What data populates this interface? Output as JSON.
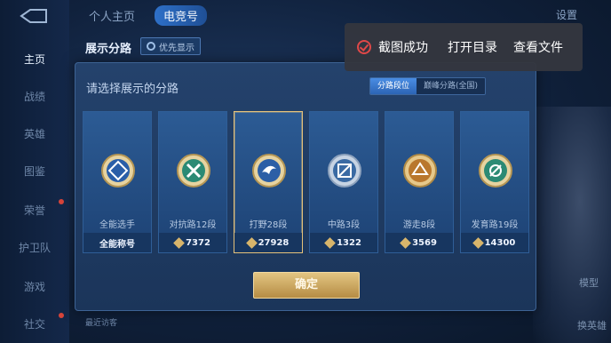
{
  "sidebar": {
    "items": [
      {
        "label": "主页"
      },
      {
        "label": "战绩"
      },
      {
        "label": "英雄"
      },
      {
        "label": "图鉴"
      },
      {
        "label": "荣誉"
      },
      {
        "label": "护卫队"
      },
      {
        "label": "游戏"
      },
      {
        "label": "社交"
      }
    ]
  },
  "topbar": {
    "tabs": [
      {
        "label": "个人主页"
      },
      {
        "label": "电竞号"
      }
    ],
    "settings": "设置"
  },
  "modal": {
    "title": "展示分路",
    "pref_button": "优先显示",
    "prompt": "请选择展示的分路",
    "segments": [
      {
        "label": "分路段位"
      },
      {
        "label": "巅峰分路(全国)"
      }
    ],
    "cards": [
      {
        "name": "全能选手",
        "value": "全能称号",
        "icon": "all-round-emblem",
        "show_coin": false
      },
      {
        "name": "对抗路12段",
        "value": "7372",
        "icon": "clash-lane-emblem",
        "show_coin": true
      },
      {
        "name": "打野28段",
        "value": "27928",
        "icon": "jungle-emblem",
        "show_coin": true
      },
      {
        "name": "中路3段",
        "value": "1322",
        "icon": "mid-lane-emblem",
        "show_coin": true
      },
      {
        "name": "游走8段",
        "value": "3569",
        "icon": "roam-emblem",
        "show_coin": true
      },
      {
        "name": "发育路19段",
        "value": "14300",
        "icon": "farm-lane-emblem",
        "show_coin": true
      }
    ],
    "confirm": "确定"
  },
  "toast": {
    "message": "截图成功",
    "open_dir": "打开目录",
    "view_file": "查看文件"
  },
  "right": {
    "labels": [
      "模型",
      "换英雄"
    ]
  },
  "bottom": {
    "text": "最近访客"
  }
}
